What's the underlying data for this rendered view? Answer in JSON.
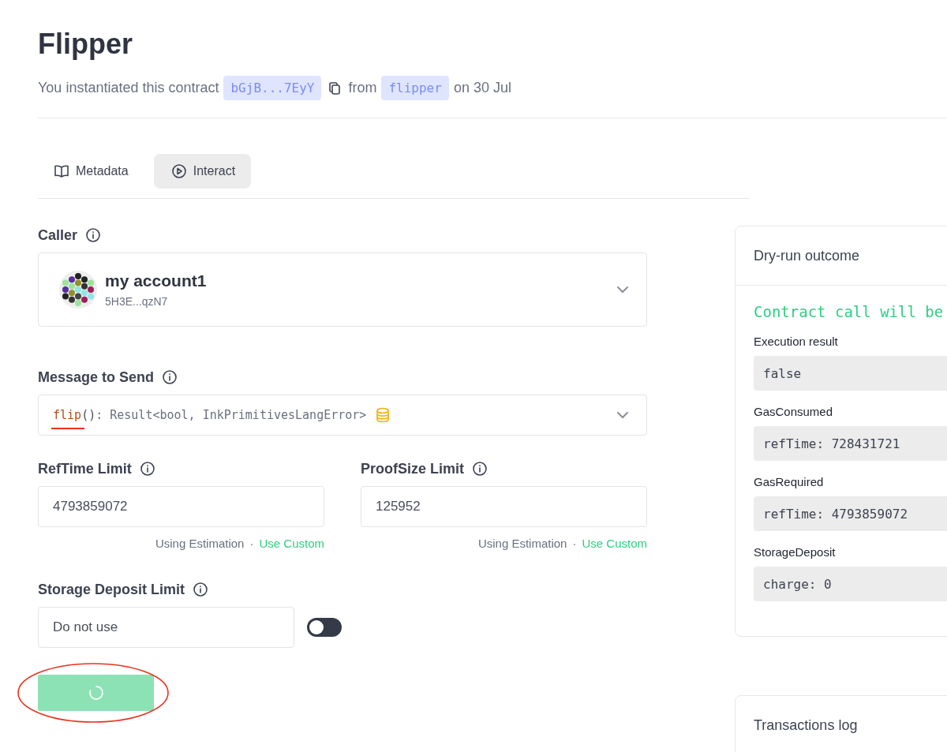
{
  "header": {
    "title": "Flipper",
    "subtitle_prefix": "You instantiated this contract",
    "address": "bGjB...7EyY",
    "from_word": "from",
    "code_name": "flipper",
    "date": "on 30 Jul"
  },
  "tabs": [
    {
      "label": "Metadata",
      "kind": "book",
      "selected": false
    },
    {
      "label": "Interact",
      "kind": "play",
      "selected": true
    }
  ],
  "caller": {
    "label": "Caller",
    "name": "my account1",
    "address": "5H3E...qzN7"
  },
  "message": {
    "label": "Message to Send",
    "name": "flip",
    "args": "()",
    "returns": ": Result<bool, InkPrimitivesLangError>",
    "payable": true,
    "underlined": true
  },
  "limits": [
    {
      "label": "RefTime Limit",
      "value": "4793859072",
      "mode": "Using Estimation",
      "separator": "·",
      "action": "Use Custom"
    },
    {
      "label": "ProofSize Limit",
      "value": "125952",
      "mode": "Using Estimation",
      "separator": "·",
      "action": "Use Custom"
    }
  ],
  "storage_limit": {
    "label": "Storage Deposit Limit",
    "placeholder": "Do not use",
    "on": false
  },
  "submit_button": {
    "loading": true,
    "circled": true
  },
  "dry_run": {
    "title": "Dry-run outcome",
    "status": "Contract call will be",
    "fields": [
      {
        "label": "Execution result",
        "value": "false"
      },
      {
        "label": "GasConsumed",
        "value": "refTime: 728431721"
      },
      {
        "label": "GasRequired",
        "value": "refTime: 4793859072"
      },
      {
        "label": "StorageDeposit",
        "value": "charge: 0"
      }
    ]
  },
  "transactions_log": {
    "title": "Transactions log"
  }
}
